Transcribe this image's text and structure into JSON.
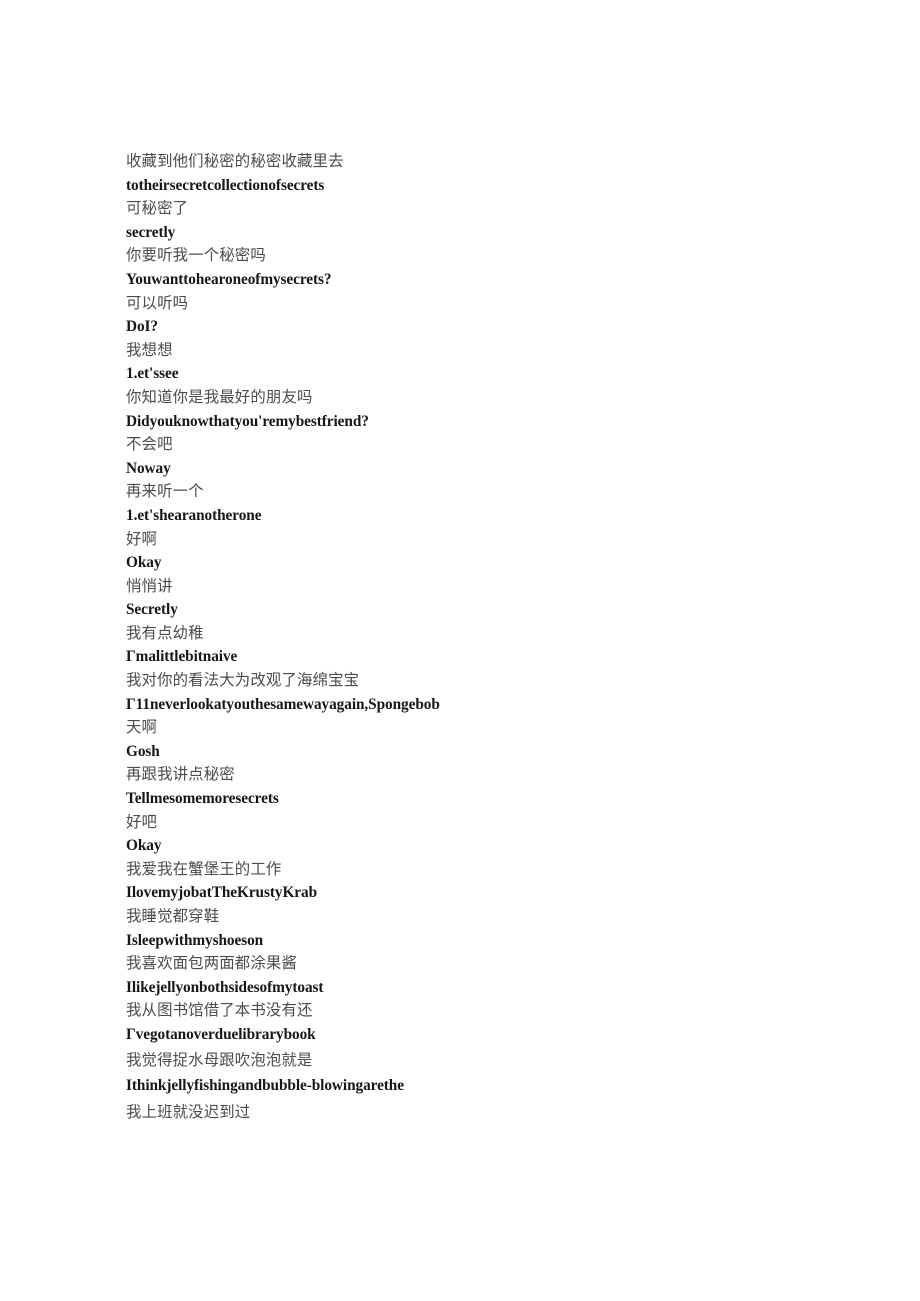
{
  "document": {
    "type": "bilingual-transcript",
    "page_background": "#ffffff",
    "zh_text_color": "#4c4c4c",
    "en_text_color": "#17171a",
    "lines": [
      {
        "lang": "zh",
        "text": "收藏到他们秘密的秘密收藏里去",
        "spacing": "normal"
      },
      {
        "lang": "en",
        "text": "totheirsecretcollectionofsecrets",
        "spacing": "normal"
      },
      {
        "lang": "zh",
        "text": "可秘密了",
        "spacing": "normal"
      },
      {
        "lang": "en",
        "text": "secretly",
        "spacing": "normal"
      },
      {
        "lang": "zh",
        "text": "你要听我一个秘密吗",
        "spacing": "normal"
      },
      {
        "lang": "en",
        "text": "Youwanttohearoneofmysecrets?",
        "spacing": "normal"
      },
      {
        "lang": "zh",
        "text": "可以听吗",
        "spacing": "normal"
      },
      {
        "lang": "en",
        "text": "DoI?",
        "spacing": "normal"
      },
      {
        "lang": "zh",
        "text": "我想想",
        "spacing": "normal"
      },
      {
        "lang": "en",
        "text": "1.et'ssee",
        "spacing": "normal"
      },
      {
        "lang": "zh",
        "text": "你知道你是我最好的朋友吗",
        "spacing": "normal"
      },
      {
        "lang": "en",
        "text": "Didyouknowthatyou'remybestfriend?",
        "spacing": "normal"
      },
      {
        "lang": "zh",
        "text": "不会吧",
        "spacing": "normal"
      },
      {
        "lang": "en",
        "text": "Noway",
        "spacing": "normal"
      },
      {
        "lang": "zh",
        "text": "再来听一个",
        "spacing": "normal"
      },
      {
        "lang": "en",
        "text": "1.et'shearanotherone",
        "spacing": "normal"
      },
      {
        "lang": "zh",
        "text": "好啊",
        "spacing": "normal"
      },
      {
        "lang": "en",
        "text": "Okay",
        "spacing": "normal"
      },
      {
        "lang": "zh",
        "text": "悄悄讲",
        "spacing": "normal"
      },
      {
        "lang": "en",
        "text": "Secretly",
        "spacing": "normal"
      },
      {
        "lang": "zh",
        "text": "我有点幼稚",
        "spacing": "normal"
      },
      {
        "lang": "en",
        "text": "Γmalittlebitnaive",
        "spacing": "normal"
      },
      {
        "lang": "zh",
        "text": "我对你的看法大为改观了海绵宝宝",
        "spacing": "normal"
      },
      {
        "lang": "en",
        "text": "Γ11neverlookatyouthesamewayagain,Spongebob",
        "spacing": "normal"
      },
      {
        "lang": "zh",
        "text": "天啊",
        "spacing": "normal"
      },
      {
        "lang": "en",
        "text": "Gosh",
        "spacing": "normal"
      },
      {
        "lang": "zh",
        "text": "再跟我讲点秘密",
        "spacing": "normal"
      },
      {
        "lang": "en",
        "text": "Tellmesomemoresecrets",
        "spacing": "normal"
      },
      {
        "lang": "zh",
        "text": "好吧",
        "spacing": "normal"
      },
      {
        "lang": "en",
        "text": "Okay",
        "spacing": "normal"
      },
      {
        "lang": "zh",
        "text": "我爱我在蟹堡王的工作",
        "spacing": "normal"
      },
      {
        "lang": "en",
        "text": "IlovemyjobatTheKrustyKrab",
        "spacing": "normal"
      },
      {
        "lang": "zh",
        "text": "我睡觉都穿鞋",
        "spacing": "normal"
      },
      {
        "lang": "en",
        "text": "Isleepwithmyshoeson",
        "spacing": "normal"
      },
      {
        "lang": "zh",
        "text": "我喜欢面包两面都涂果酱",
        "spacing": "normal"
      },
      {
        "lang": "en",
        "text": "Ilikejellyonbothsidesofmytoast",
        "spacing": "normal"
      },
      {
        "lang": "zh",
        "text": "我从图书馆借了本书没有还",
        "spacing": "normal"
      },
      {
        "lang": "en",
        "text": "Γvegotanoverduelibrarybook",
        "spacing": "normal"
      },
      {
        "lang": "zh",
        "text": "我觉得捉水母跟吹泡泡就是",
        "spacing": "loose"
      },
      {
        "lang": "en",
        "text": "Ithinkjellyfishingandbubble-blowingarethe",
        "spacing": "loose"
      },
      {
        "lang": "zh",
        "text": "我上班就没迟到过",
        "spacing": "loose"
      }
    ]
  }
}
